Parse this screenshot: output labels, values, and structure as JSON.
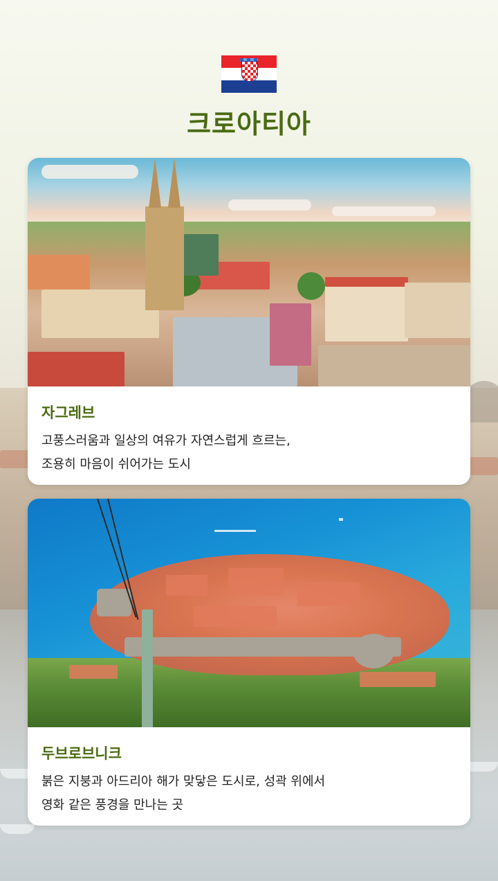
{
  "country": {
    "name": "크로아티아",
    "flag_icon": "croatia-flag-icon",
    "flag_colors": [
      "#e8232a",
      "#ffffff",
      "#1d3f93"
    ]
  },
  "accent_color": "#4a6b12",
  "cities": [
    {
      "name": "자그레브",
      "description_line1": "고풍스러움과 일상의 여유가 자연스럽게 흐르는,",
      "description_line2": "조용히 마음이 쉬어가는 도시",
      "image": "zagreb-cathedral-cityscape"
    },
    {
      "name": "두브로브니크",
      "description_line1": "붉은 지붕과 아드리아 해가 맞닿은 도시로, 성곽 위에서",
      "description_line2": "영화 같은 풍경을 만나는 곳",
      "image": "dubrovnik-old-town-aerial"
    }
  ]
}
